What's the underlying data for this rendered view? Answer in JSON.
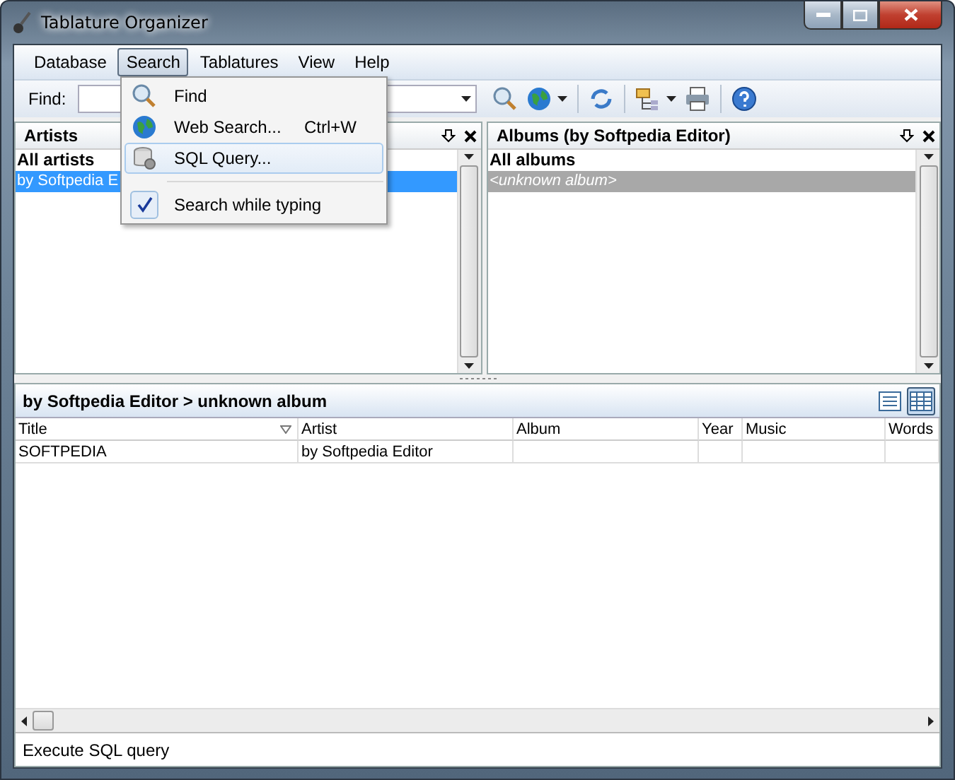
{
  "window": {
    "title": "Tablature Organizer"
  },
  "menu": [
    {
      "label": "Database",
      "selected": false
    },
    {
      "label": "Search",
      "selected": true
    },
    {
      "label": "Tablatures",
      "selected": false
    },
    {
      "label": "View",
      "selected": false
    },
    {
      "label": "Help",
      "selected": false
    }
  ],
  "search_menu": [
    {
      "kind": "item",
      "label": "Find",
      "highlighted": false
    },
    {
      "kind": "item",
      "label": "Web Search...",
      "shortcut": "Ctrl+W",
      "highlighted": false
    },
    {
      "kind": "item",
      "label": "SQL Query...",
      "highlighted": true
    },
    {
      "kind": "check",
      "label": "Search while typing",
      "checked": true,
      "highlighted": false
    }
  ],
  "find": {
    "label": "Find:"
  },
  "artists": {
    "title": "Artists",
    "items": [
      {
        "kind": "all",
        "label": "All artists",
        "selected": false
      },
      {
        "kind": "entry",
        "label": "by Softpedia E",
        "selected": true
      }
    ]
  },
  "albums": {
    "title": "Albums (by Softpedia Editor)",
    "items": [
      {
        "kind": "all",
        "label": "All albums",
        "selected": false
      },
      {
        "kind": "unknown",
        "label": "<unknown album>",
        "selected": true
      }
    ]
  },
  "tracks": {
    "breadcrumb": "by Softpedia Editor > unknown album",
    "views": [
      {
        "kind": "list",
        "selected": false
      },
      {
        "kind": "details",
        "selected": true
      }
    ],
    "columns": [
      "Title",
      "Artist",
      "Album",
      "Year",
      "Music",
      "Words"
    ],
    "rows": [
      [
        "SOFTPEDIA",
        "by Softpedia Editor",
        "",
        "",
        "",
        ""
      ]
    ]
  },
  "status_bar": "Execute SQL query"
}
